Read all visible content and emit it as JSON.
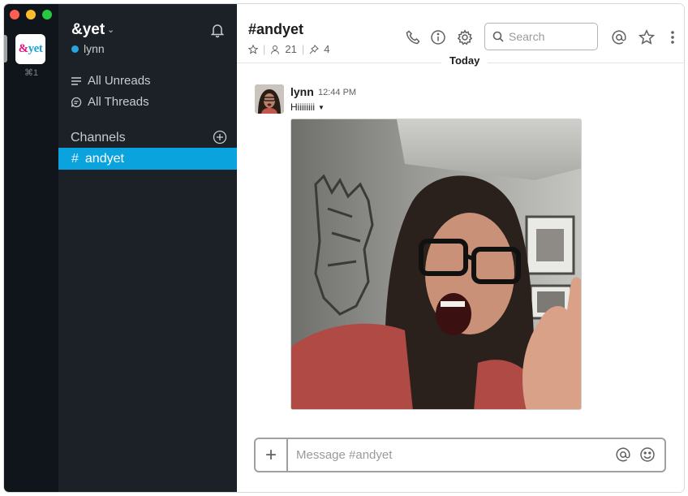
{
  "workspace": {
    "logo_amp": "&",
    "logo_word": "yet",
    "shortcut": "⌘1"
  },
  "sidebar": {
    "team_name": "&yet",
    "user_name": "lynn",
    "presence_color": "#29a3de",
    "nav": [
      {
        "label": "All Unreads",
        "icon": "all-unreads-icon"
      },
      {
        "label": "All Threads",
        "icon": "threads-icon"
      }
    ],
    "channels_header": "Channels",
    "channels": [
      {
        "label": "andyet",
        "active": true
      }
    ],
    "accent_color": "#0ba3de"
  },
  "header": {
    "channel_title": "#andyet",
    "members_count": "21",
    "pinned_count": "4",
    "search_placeholder": "Search"
  },
  "messages": {
    "day_divider": "Today",
    "items": [
      {
        "author": "lynn",
        "time": "12:44 PM",
        "text": "Hiiiiiiii"
      }
    ]
  },
  "composer": {
    "placeholder": "Message #andyet",
    "plus_label": "+"
  }
}
